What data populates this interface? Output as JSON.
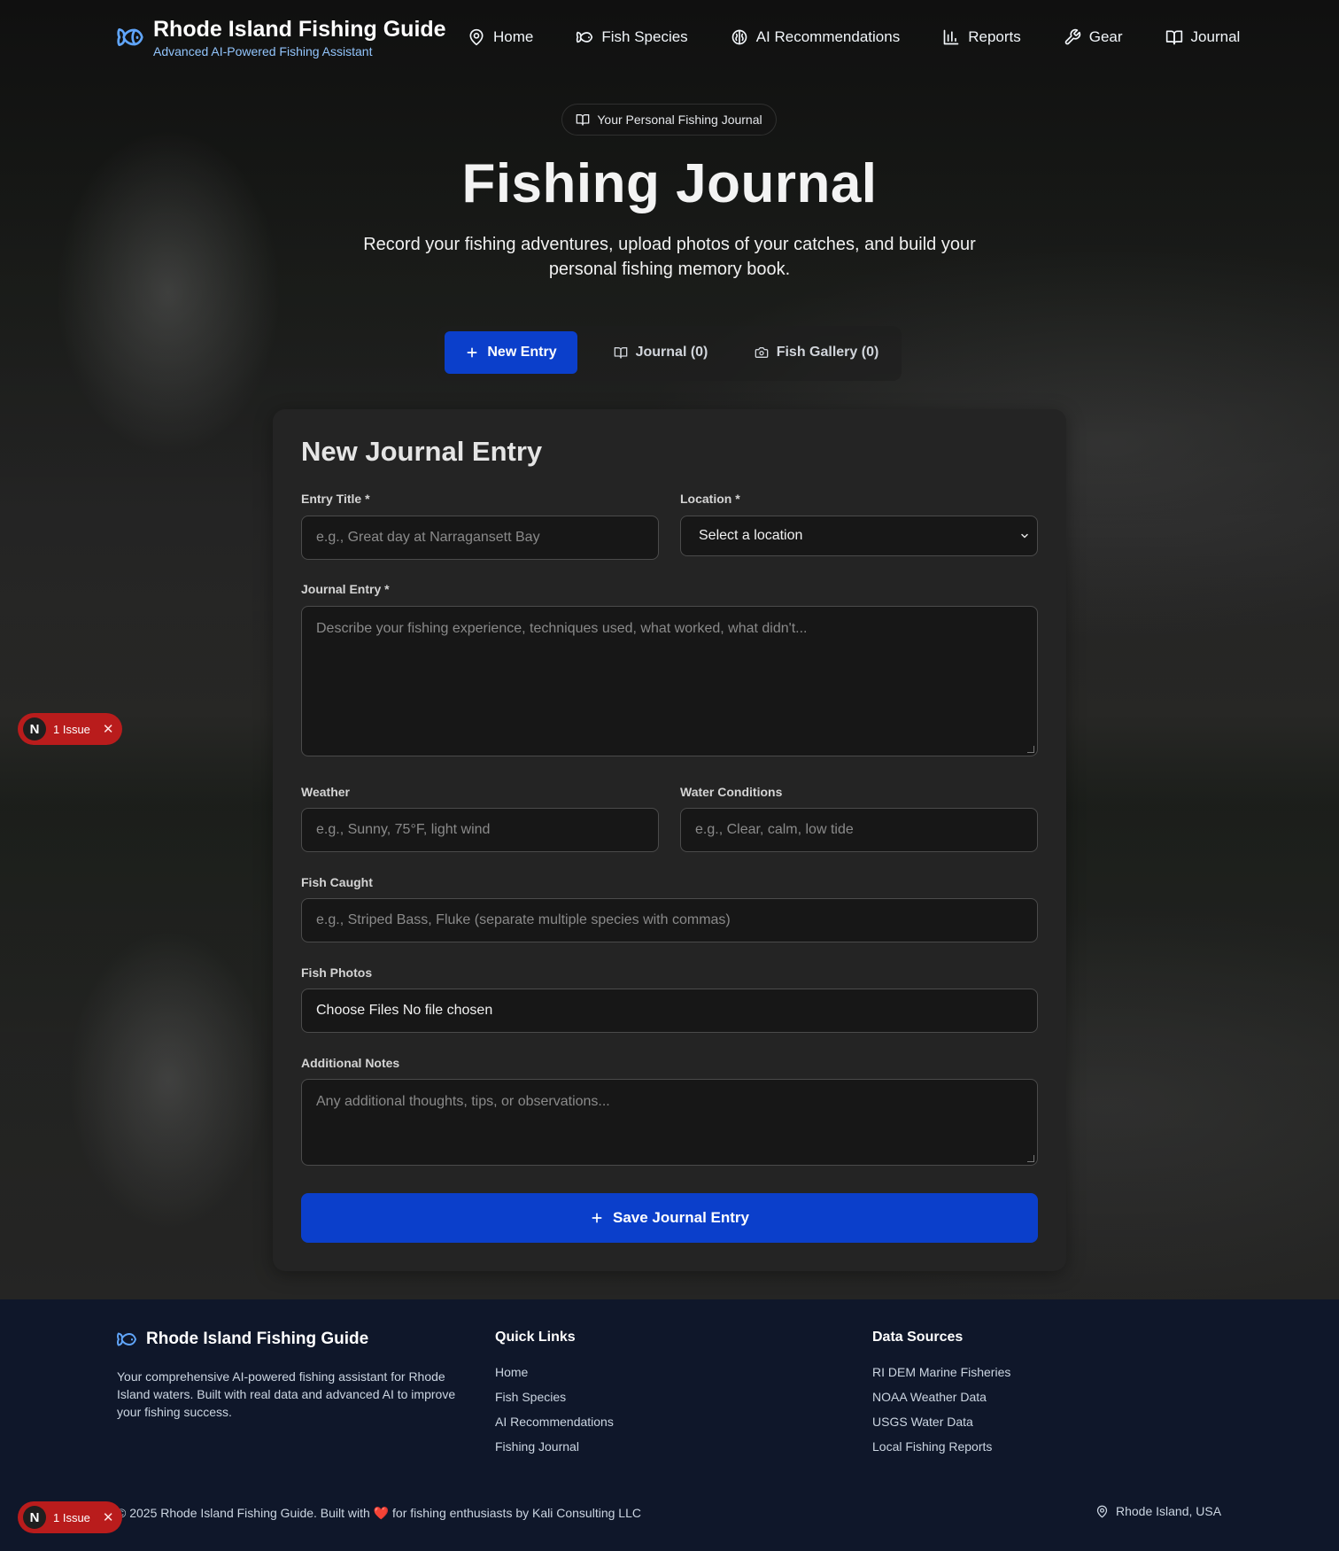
{
  "header": {
    "title": "Rhode Island Fishing Guide",
    "subtitle": "Advanced AI-Powered Fishing Assistant",
    "nav": [
      {
        "label": "Home",
        "icon": "map-pin-icon"
      },
      {
        "label": "Fish Species",
        "icon": "fish-icon"
      },
      {
        "label": "AI Recommendations",
        "icon": "brain-icon"
      },
      {
        "label": "Reports",
        "icon": "bar-chart-icon"
      },
      {
        "label": "Gear",
        "icon": "wrench-icon"
      },
      {
        "label": "Journal",
        "icon": "book-icon"
      }
    ]
  },
  "hero": {
    "pill": "Your Personal Fishing Journal",
    "title": "Fishing Journal",
    "description": "Record your fishing adventures, upload photos of your catches, and build your personal fishing memory book."
  },
  "tabs": [
    {
      "label": "New Entry",
      "icon": "plus-icon",
      "active": true
    },
    {
      "label": "Journal (0)",
      "icon": "book-icon",
      "active": false
    },
    {
      "label": "Fish Gallery (0)",
      "icon": "camera-icon",
      "active": false
    }
  ],
  "form": {
    "title": "New Journal Entry",
    "entry_title": {
      "label": "Entry Title *",
      "placeholder": "e.g., Great day at Narragansett Bay"
    },
    "location": {
      "label": "Location *",
      "value": "Select a location"
    },
    "journal_entry": {
      "label": "Journal Entry *",
      "placeholder": "Describe your fishing experience, techniques used, what worked, what didn't..."
    },
    "weather": {
      "label": "Weather",
      "placeholder": "e.g., Sunny, 75°F, light wind"
    },
    "water": {
      "label": "Water Conditions",
      "placeholder": "e.g., Clear, calm, low tide"
    },
    "fish_caught": {
      "label": "Fish Caught",
      "placeholder": "e.g., Striped Bass, Fluke (separate multiple species with commas)"
    },
    "fish_photos": {
      "label": "Fish Photos",
      "value": "Choose Files No file chosen"
    },
    "notes": {
      "label": "Additional Notes",
      "placeholder": "Any additional thoughts, tips, or observations..."
    },
    "save_label": "Save Journal Entry"
  },
  "issue_badge": {
    "letter": "N",
    "label": "1 Issue",
    "close": "✕"
  },
  "footer": {
    "brand": "Rhode Island Fishing Guide",
    "description": "Your comprehensive AI-powered fishing assistant for Rhode Island waters. Built with real data and advanced AI to improve your fishing success.",
    "quick_links_title": "Quick Links",
    "quick_links": [
      "Home",
      "Fish Species",
      "AI Recommendations",
      "Fishing Journal"
    ],
    "data_sources_title": "Data Sources",
    "data_sources": [
      "RI DEM Marine Fisheries",
      "NOAA Weather Data",
      "USGS Water Data",
      "Local Fishing Reports"
    ],
    "copyright_pre": "© 2025 Rhode Island Fishing Guide. Built with",
    "copyright_heart": "❤️",
    "copyright_post": "for fishing enthusiasts by Kali Consulting LLC",
    "location": "Rhode Island, USA"
  },
  "colors": {
    "accent": "#0b3fcb",
    "brand_icon": "#60a5fa",
    "issue_badge": "#b91c1c",
    "footer_bg": "#0f172a"
  }
}
